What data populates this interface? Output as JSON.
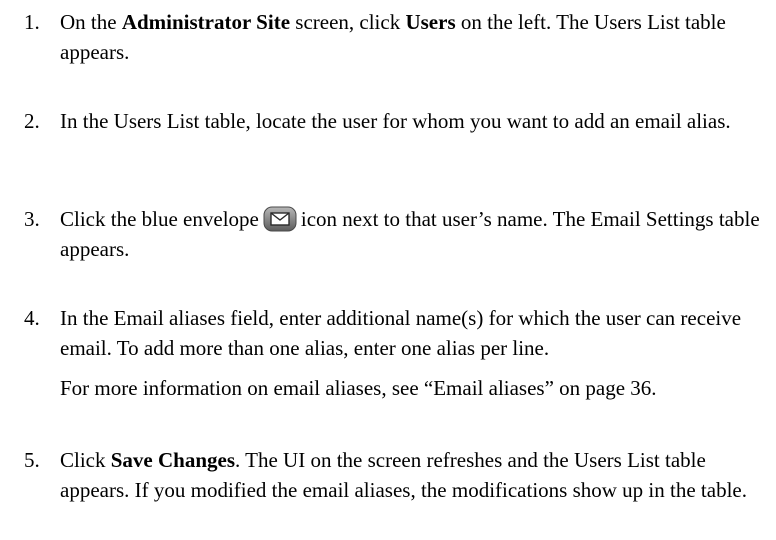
{
  "steps": [
    {
      "number": "1.",
      "pre": "On the ",
      "bold1": "Administrator Site",
      "mid": " screen, click ",
      "bold2": "Users",
      "post": " on the left. The Users List table appears."
    },
    {
      "number": "2.",
      "text": "In the Users List table, locate the user for whom you want to add an email alias."
    },
    {
      "number": "3.",
      "pre": "Click the blue envelope",
      "icon": "envelope-icon",
      "post": "icon next to that user’s name. The Email Settings table appears."
    },
    {
      "number": "4.",
      "text": "In the Email aliases field, enter additional name(s) for which the user can receive email. To add more than one alias, enter one alias per line.",
      "note": "For more information on email aliases, see “Email aliases” on page 36."
    },
    {
      "number": "5.",
      "pre": "Click ",
      "bold": "Save Changes",
      "post": ". The UI on the screen refreshes and the Users List table appears. If you modified the email aliases, the modifications show up in the table."
    }
  ],
  "colors": {
    "envelope_fill": "#8a8a8a",
    "envelope_stroke": "#4a4a4a"
  }
}
